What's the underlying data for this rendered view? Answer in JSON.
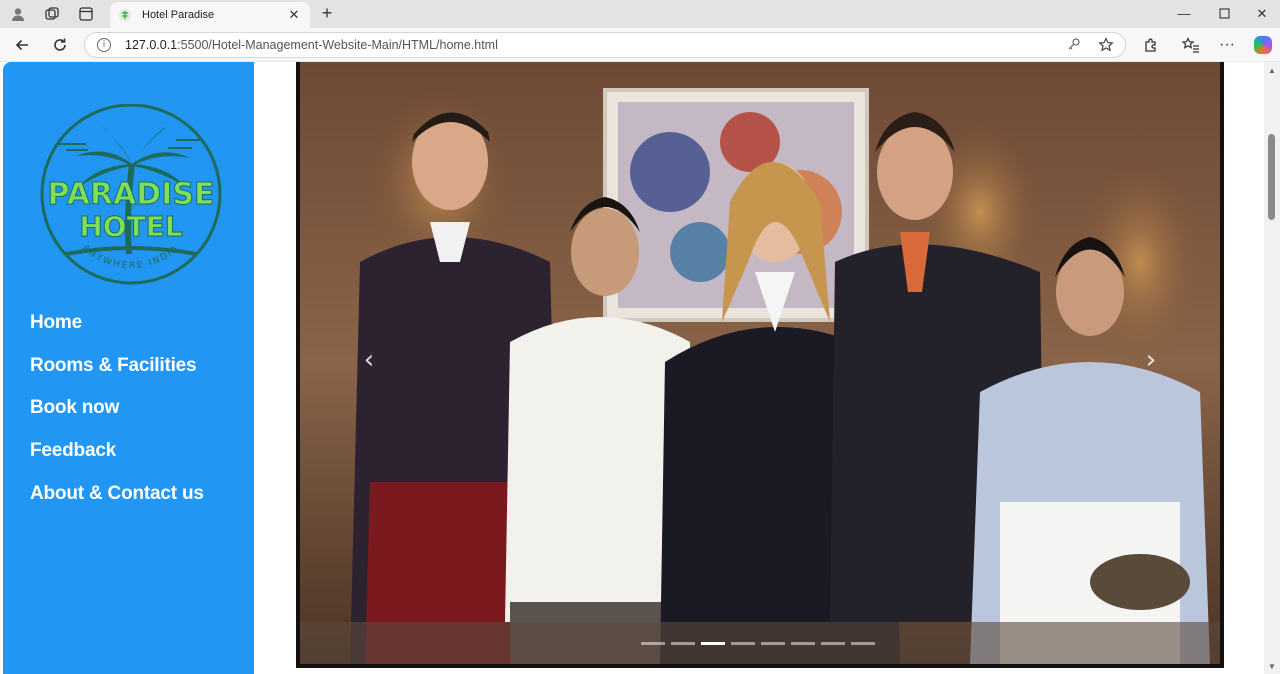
{
  "browser": {
    "tab_title": "Hotel Paradise",
    "url_host": "127.0.0.1",
    "url_rest": ":5500/Hotel-Management-Website-Main/HTML/home.html",
    "icons": [
      "profile-icon",
      "workspaces-icon",
      "tab-actions-icon",
      "favicon",
      "close-icon",
      "new-tab-icon",
      "minimize-icon",
      "maximize-icon",
      "window-close-icon",
      "back-icon",
      "reload-icon",
      "site-info-icon",
      "key-icon",
      "star-icon",
      "extensions-icon",
      "favorites-icon",
      "more-icon",
      "copilot-icon"
    ]
  },
  "logo": {
    "line1": "PARADISE",
    "line2": "HOTEL",
    "tagline": "ANYWHERE INDIA",
    "colors": {
      "circle": "#1f6b59",
      "text": "#7ee05a"
    }
  },
  "menu": {
    "items": [
      {
        "label": "Home"
      },
      {
        "label": "Rooms & Facilities"
      },
      {
        "label": "Book now"
      },
      {
        "label": "Feedback"
      },
      {
        "label": "About & Contact us"
      }
    ]
  },
  "carousel": {
    "image_description": "Hotel staff team photo",
    "prev_glyph": "‹",
    "next_glyph": "›",
    "slide_count": 8,
    "active_slide": 3
  },
  "colors": {
    "sidebar": "#2196f3",
    "browser_bg": "#f7f7f7"
  }
}
